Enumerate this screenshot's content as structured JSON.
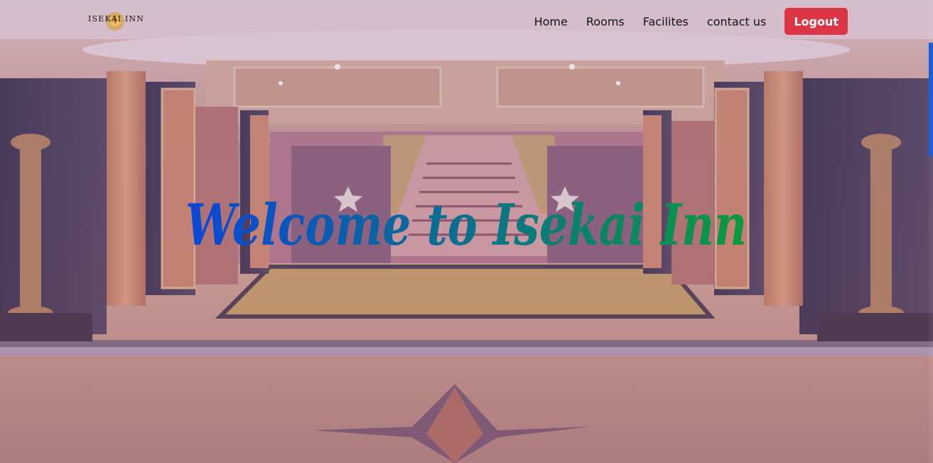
{
  "brand": {
    "logo_text": "ISEKAI INN"
  },
  "nav": {
    "items": [
      {
        "label": "Home"
      },
      {
        "label": "Rooms"
      },
      {
        "label": "Facilites"
      },
      {
        "label": "contact us"
      }
    ],
    "logout_label": "Logout"
  },
  "hero": {
    "title": "Welcome to Isekai Inn",
    "title_gradient": [
      "#0b47d8",
      "#0a9a3e"
    ]
  },
  "colors": {
    "logout_bg": "#dc3545",
    "scroll_thumb": "#1a5fd8"
  },
  "icons": {
    "logo_mark": "lotus-emblem-icon"
  }
}
